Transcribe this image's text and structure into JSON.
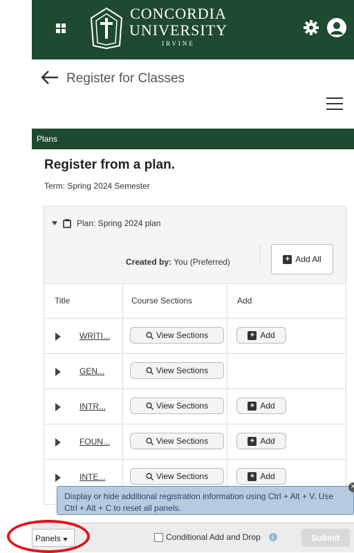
{
  "header": {
    "logo_line1": "CONCORDIA",
    "logo_line2": "UNIVERSITY",
    "logo_line3": "IRVINE",
    "brand_color": "#1e4a2f"
  },
  "subheader": {
    "title": "Register for Classes"
  },
  "plans_bar": {
    "label": "Plans"
  },
  "main": {
    "heading": "Register from a plan.",
    "term": "Term: Spring 2024 Semester",
    "plan_label": "Plan: Spring 2024 plan",
    "created_by_label": "Created by:",
    "created_by_value": "You (Preferred)",
    "add_all_label": "Add All",
    "columns": [
      "Title",
      "Course Sections",
      "Add"
    ],
    "rows": [
      {
        "title": "WRITI...",
        "view_label": "View Sections",
        "add_label": "Add"
      },
      {
        "title": "GEN...",
        "view_label": "View Sections",
        "add_label": ""
      },
      {
        "title": "INTR...",
        "view_label": "View Sections",
        "add_label": "Add"
      },
      {
        "title": "FOUN...",
        "view_label": "View Sections",
        "add_label": "Add"
      },
      {
        "title": "INTE...",
        "view_label": "View Sections",
        "add_label": "Add"
      }
    ]
  },
  "tooltip": {
    "text": "Display or hide additional registration information using Ctrl + Alt + V. Use Ctrl + Alt + C to reset all panels."
  },
  "footer": {
    "panels_label": "Panels",
    "conditional_label": "Conditional Add and Drop",
    "submit_label": "Submit"
  }
}
